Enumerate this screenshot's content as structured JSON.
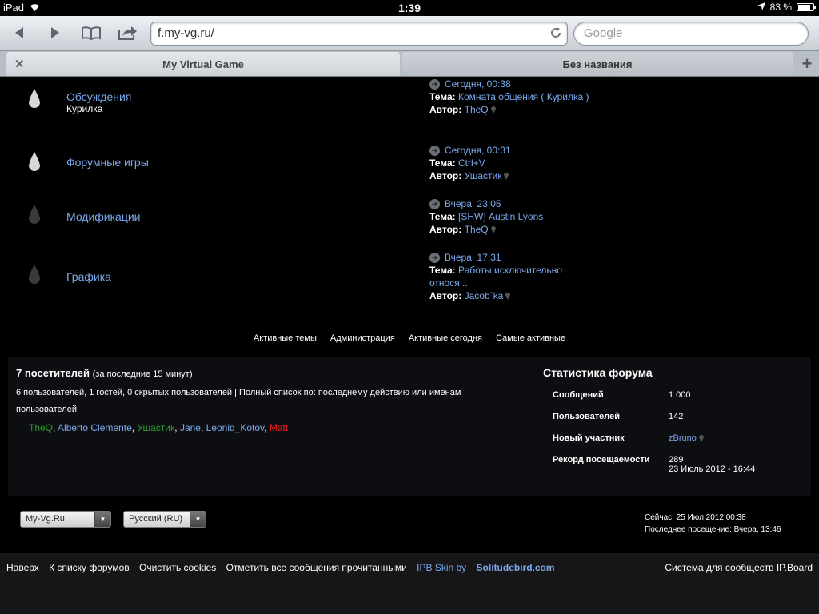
{
  "status": {
    "device": "iPad",
    "time": "1:39",
    "battery": "83 %",
    "battery_level": 0.83
  },
  "browser": {
    "url": "f.my-vg.ru/",
    "search_placeholder": "Google",
    "tabs": [
      {
        "label": "My Virtual Game"
      },
      {
        "label": "Без названия"
      }
    ]
  },
  "forums": [
    {
      "title": "Обсуждения",
      "subforum": "Курилка",
      "date": "Сегодня, 00:38",
      "topic_key": "Тема:",
      "topic": "Комната общения ( Курилка )",
      "author_key": "Автор:",
      "author": "TheQ"
    },
    {
      "title": "Форумные игры",
      "subforum": "",
      "date": "Сегодня, 00:31",
      "topic_key": "Тема:",
      "topic": "Ctrl+V",
      "author_key": "Автор:",
      "author": "Ушастик"
    },
    {
      "title": "Модификации",
      "subforum": "",
      "date": "Вчера, 23:05",
      "topic_key": "Тема:",
      "topic": "[SHW] Austin Lyons",
      "author_key": "Автор:",
      "author": "TheQ"
    },
    {
      "title": "Графика",
      "subforum": "",
      "date": "Вчера, 17:31",
      "topic_key": "Тема:",
      "topic": "Работы исключительно относя...",
      "author_key": "Автор:",
      "author": "Jacob`ka"
    }
  ],
  "quicklinks": [
    "Активные темы",
    "Администрация",
    "Активные сегодня",
    "Самые активные"
  ],
  "online": {
    "title": "7 посетителей",
    "period": "(за последние 15 минут)",
    "description": "6 пользователей, 1 гостей, 0 скрытых пользователей | Полный список по: последнему действию или именам пользователей",
    "users": [
      {
        "name": "TheQ",
        "color": "#2a9e2a"
      },
      {
        "name": "Alberto Clemente",
        "color": "#7ba9ec"
      },
      {
        "name": "Ушастик",
        "color": "#2a9e2a"
      },
      {
        "name": "Jane",
        "color": "#7ba9ec"
      },
      {
        "name": "Leonid_Kotov",
        "color": "#7ba9ec"
      },
      {
        "name": "Matt",
        "color": "#e22222"
      }
    ]
  },
  "stats": {
    "title": "Статистика форума",
    "rows": [
      {
        "label": "Сообщений",
        "value": "1 000",
        "value2": ""
      },
      {
        "label": "Пользователей",
        "value": "142",
        "value2": ""
      },
      {
        "label": "Новый участник",
        "value": "zBruno",
        "value2": ""
      },
      {
        "label": "Рекорд посещаемости",
        "value": "289",
        "value2": "23 Июль 2012 - 16:44"
      }
    ]
  },
  "selects": {
    "skin": "My-Vg.Ru",
    "language": "Русский (RU)"
  },
  "time_info": {
    "now": "Сейчас: 25 Июл 2012 00:38",
    "last_visit": "Последнее посещение: Вчера, 13:46"
  },
  "footer": {
    "links": [
      "Наверх",
      "К списку форумов",
      "Очистить cookies",
      "Отметить все сообщения прочитанными"
    ],
    "skin_prefix": "IPB Skin by ",
    "skin_author": "Solitudebird.com",
    "right": "Система для сообществ IP.Board"
  }
}
